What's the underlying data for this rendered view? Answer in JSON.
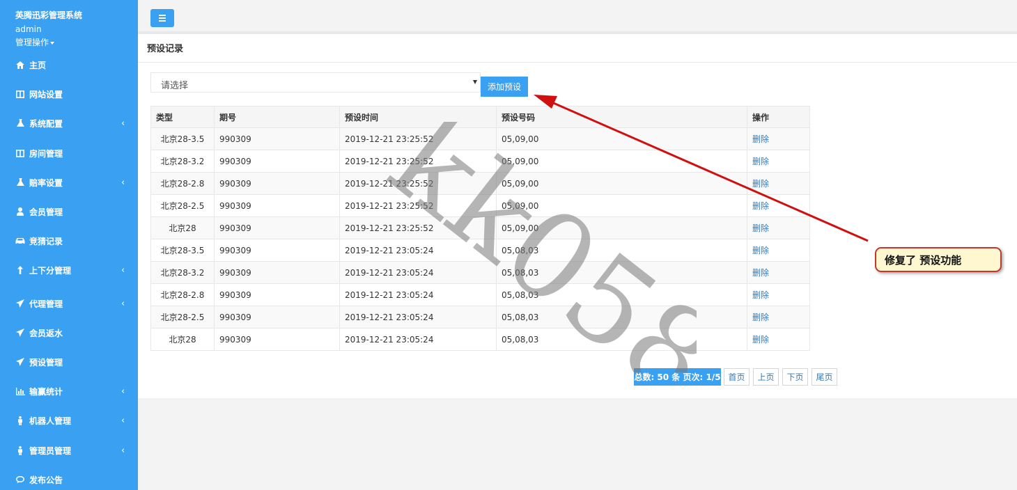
{
  "sidebar": {
    "brand": "英腾迅彩管理系统",
    "user": "admin",
    "manage": "管理操作",
    "items": [
      {
        "label": "主页",
        "icon": "home-icon",
        "chevron": ""
      },
      {
        "label": "网站设置",
        "icon": "columns-icon",
        "chevron": ""
      },
      {
        "label": "系统配置",
        "icon": "flask-icon",
        "chevron": "‹"
      },
      {
        "label": "房间管理",
        "icon": "columns-icon",
        "chevron": ""
      },
      {
        "label": "赔率设置",
        "icon": "flask-icon",
        "chevron": "‹"
      },
      {
        "label": "会员管理",
        "icon": "user-icon",
        "chevron": ""
      },
      {
        "label": "竞猜记录",
        "icon": "car-icon",
        "chevron": ""
      },
      {
        "label": "上下分管理",
        "icon": "level-up-icon",
        "chevron": "‹"
      },
      {
        "label": "代理管理",
        "icon": "paper-plane-icon",
        "chevron": "‹"
      },
      {
        "label": "会员返水",
        "icon": "paper-plane-icon",
        "chevron": ""
      },
      {
        "label": "预设管理",
        "icon": "paper-plane-icon",
        "chevron": ""
      },
      {
        "label": "输赢统计",
        "icon": "bar-chart-icon",
        "chevron": "‹"
      },
      {
        "label": "机器人管理",
        "icon": "male-icon",
        "chevron": "‹"
      },
      {
        "label": "管理员管理",
        "icon": "male-icon",
        "chevron": "‹"
      },
      {
        "label": "发布公告",
        "icon": "comment-icon",
        "chevron": ""
      }
    ]
  },
  "panel": {
    "title": "预设记录",
    "select_value": "请选择",
    "add_button": "添加预设"
  },
  "table": {
    "headers": [
      "类型",
      "期号",
      "预设时间",
      "预设号码",
      "操作"
    ],
    "rows": [
      [
        "北京28-3.5",
        "990309",
        "2019-12-21 23:25:52",
        "05,09,00",
        "删除"
      ],
      [
        "北京28-3.2",
        "990309",
        "2019-12-21 23:25:52",
        "05,09,00",
        "删除"
      ],
      [
        "北京28-2.8",
        "990309",
        "2019-12-21 23:25:52",
        "05,09,00",
        "删除"
      ],
      [
        "北京28-2.5",
        "990309",
        "2019-12-21 23:25:52",
        "05,09,00",
        "删除"
      ],
      [
        "北京28",
        "990309",
        "2019-12-21 23:25:52",
        "05,09,00",
        "删除"
      ],
      [
        "北京28-3.5",
        "990309",
        "2019-12-21 23:05:24",
        "05,08,03",
        "删除"
      ],
      [
        "北京28-3.2",
        "990309",
        "2019-12-21 23:05:24",
        "05,08,03",
        "删除"
      ],
      [
        "北京28-2.8",
        "990309",
        "2019-12-21 23:05:24",
        "05,08,03",
        "删除"
      ],
      [
        "北京28-2.5",
        "990309",
        "2019-12-21 23:05:24",
        "05,08,03",
        "删除"
      ],
      [
        "北京28",
        "990309",
        "2019-12-21 23:05:24",
        "05,08,03",
        "删除"
      ]
    ]
  },
  "pagination": {
    "total": "总数: 50 条 页次: 1/5",
    "first": "首页",
    "prev": "上页",
    "next": "下页",
    "last": "尾页"
  },
  "watermark": "kk058",
  "annotation": "修复了 预设功能",
  "colors": {
    "accent": "#3aa1f2",
    "link": "#337ab7",
    "arrow": "#d01010"
  }
}
